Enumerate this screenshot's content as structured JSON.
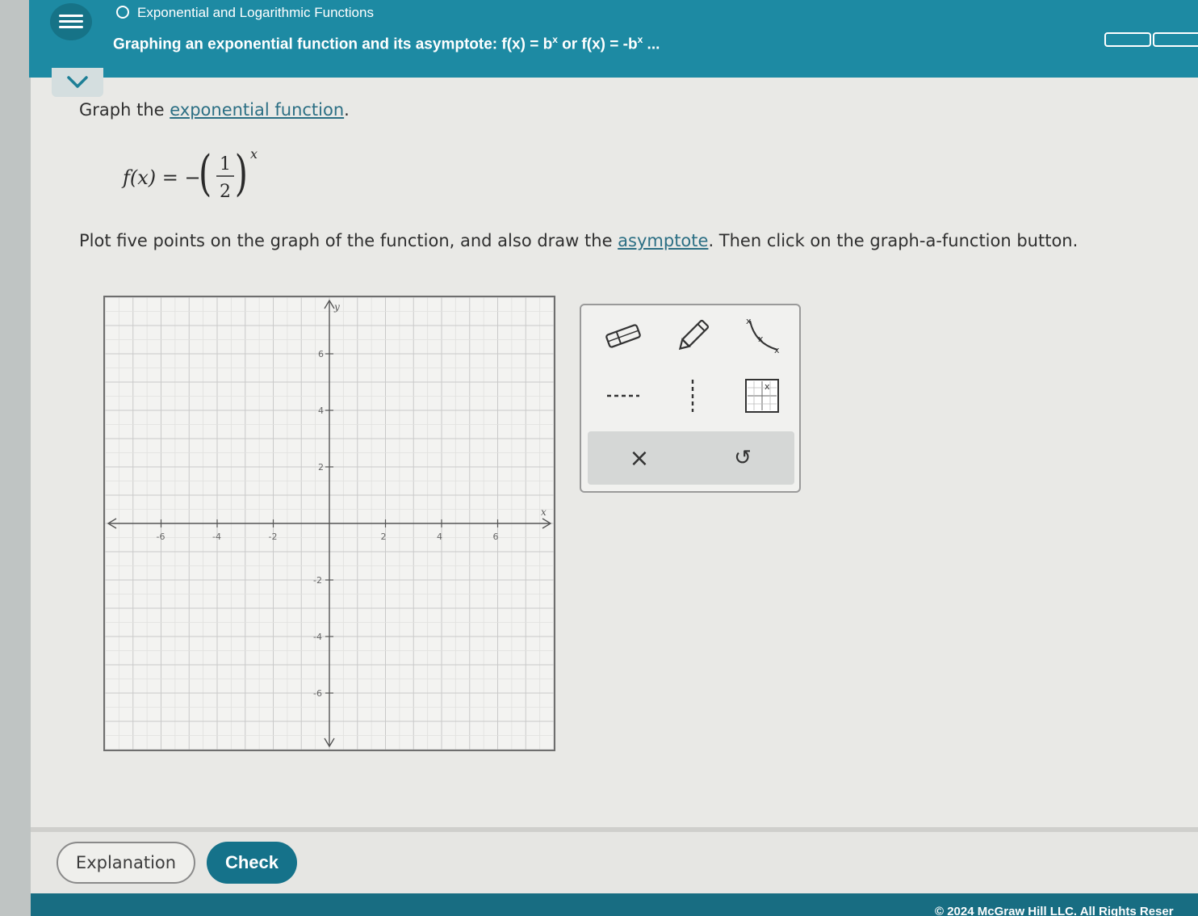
{
  "header": {
    "topic": "Exponential and Logarithmic Functions",
    "subtitle": "Graphing an exponential function and its asymptote: f(x) = b",
    "subtitle_sup1": "x",
    "subtitle_mid": " or f(x) = -b",
    "subtitle_sup2": "x",
    "subtitle_end": " ...",
    "menu_icon": "hamburger-icon",
    "colors": {
      "header_bg": "#1d8aa3",
      "button_primary": "#15728a"
    }
  },
  "question": {
    "instruction_prefix": "Graph the ",
    "instruction_link": "exponential function",
    "instruction_suffix": ".",
    "formula": {
      "lhs": "f(x) = −",
      "numerator": "1",
      "denominator": "2",
      "exponent": "x"
    },
    "plot_prefix": "Plot five points on the graph of the function, and also draw the ",
    "plot_link": "asymptote",
    "plot_suffix": ". Then click on the graph-a-function button."
  },
  "graph": {
    "x_label": "x",
    "y_label": "y",
    "x_ticks": [
      "-6",
      "-4",
      "-2",
      "2",
      "4",
      "6"
    ],
    "y_ticks": [
      "6",
      "4",
      "2",
      "-2",
      "-4",
      "-6"
    ],
    "x_range": [
      -8,
      8
    ],
    "y_range": [
      -8,
      8
    ],
    "grid": true
  },
  "tools": {
    "eraser": "eraser-icon",
    "pencil": "pencil-icon",
    "curve": "exponential-curve-icon",
    "horizontal_asymptote": "horizontal-dashed-line-icon",
    "vertical_asymptote": "vertical-dashed-line-icon",
    "graph_function": "graph-function-icon",
    "clear": "×",
    "undo": "↺"
  },
  "footer": {
    "explanation_label": "Explanation",
    "check_label": "Check",
    "copyright": "© 2024 McGraw Hill LLC. All Rights Reser"
  }
}
